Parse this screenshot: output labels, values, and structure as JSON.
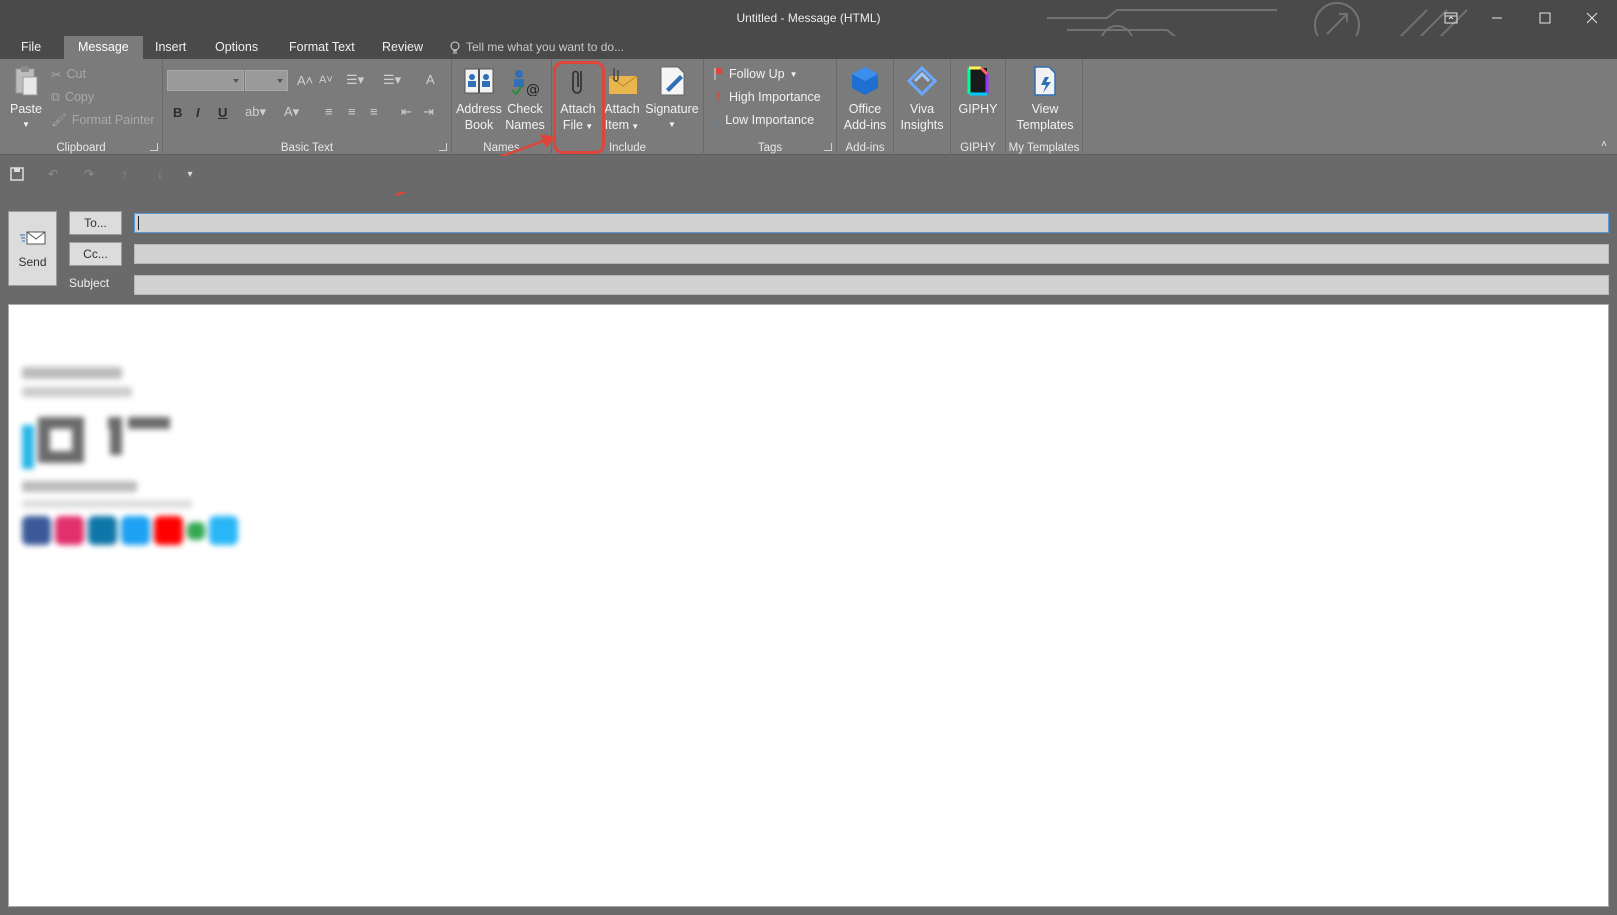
{
  "window": {
    "title": "Untitled - Message (HTML)",
    "controls": [
      "ribbon-display",
      "minimize",
      "maximize",
      "close"
    ]
  },
  "tabs": [
    {
      "label": "File"
    },
    {
      "label": "Message",
      "active": true
    },
    {
      "label": "Insert"
    },
    {
      "label": "Options"
    },
    {
      "label": "Format Text"
    },
    {
      "label": "Review"
    }
  ],
  "tell_me": "Tell me what you want to do...",
  "ribbon": {
    "clipboard": {
      "label": "Clipboard",
      "paste": "Paste",
      "cut": "Cut",
      "copy": "Copy",
      "format_painter": "Format Painter"
    },
    "basic_text": {
      "label": "Basic Text",
      "bold": "B",
      "italic": "I",
      "underline": "U"
    },
    "names": {
      "label": "Names",
      "address_book": [
        "Address",
        "Book"
      ],
      "check_names": [
        "Check",
        "Names"
      ]
    },
    "include": {
      "label": "Include",
      "attach_file": [
        "Attach",
        "File"
      ],
      "attach_item": [
        "Attach",
        "Item"
      ],
      "signature": "Signature"
    },
    "tags": {
      "label": "Tags",
      "follow_up": "Follow Up",
      "high_importance": "High Importance",
      "low_importance": "Low Importance"
    },
    "addins": {
      "label": "Add-ins",
      "office_addins": [
        "Office",
        "Add-ins"
      ]
    },
    "viva": [
      "Viva",
      "Insights"
    ],
    "giphy": {
      "label": "GIPHY",
      "button": "GIPHY"
    },
    "my_templates": {
      "label": "My Templates",
      "view_templates": [
        "View",
        "Templates"
      ]
    }
  },
  "compose": {
    "send": "Send",
    "to": "To...",
    "cc": "Cc...",
    "subject": "Subject",
    "to_value": "",
    "cc_value": "",
    "subject_value": ""
  },
  "colors": {
    "accent_highlight": "#e0453a",
    "logo_blue": "#29b6e8",
    "focus_border": "#5b9bd5"
  }
}
